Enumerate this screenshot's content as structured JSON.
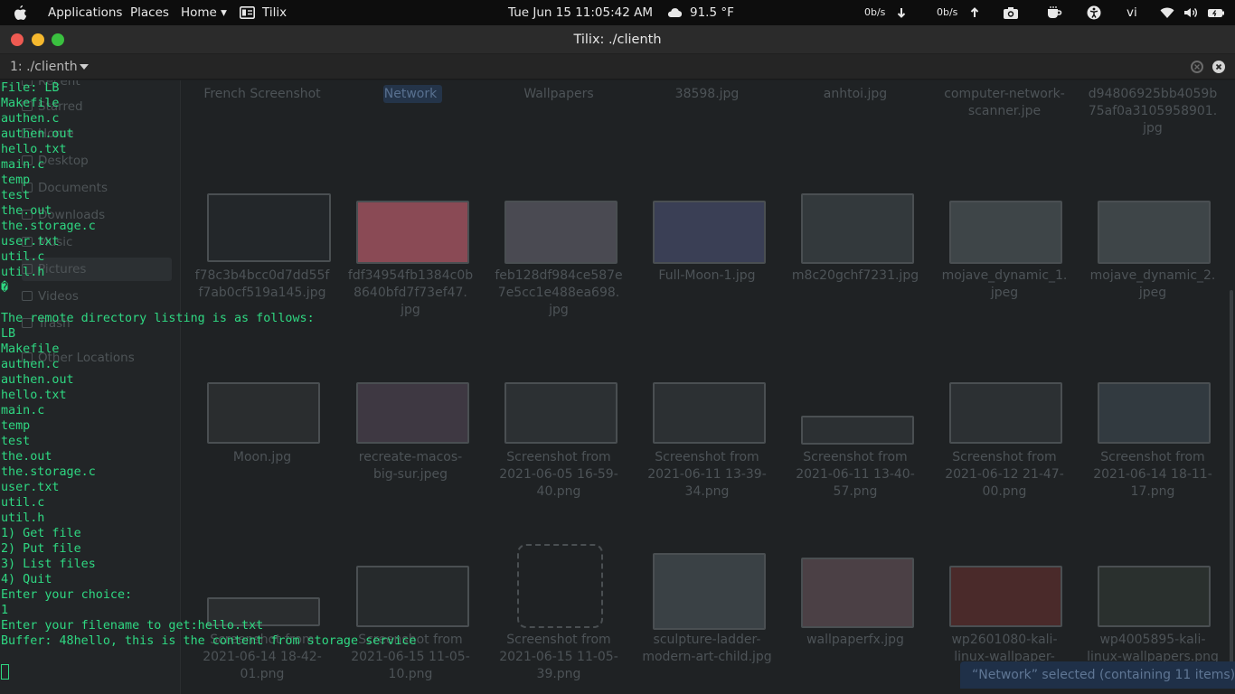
{
  "topbar": {
    "applications": "Applications",
    "places": "Places",
    "home": "Home ▾",
    "app_name": "Tilix",
    "clock": "Tue Jun 15  11:05:42 AM",
    "weather": "91.5 °F",
    "net_down": "0b/s",
    "net_up": "0b/s",
    "keyboard": "vi"
  },
  "window": {
    "title": "Tilix: ./clienth",
    "session_label": "1: ./clienth"
  },
  "terminal": {
    "lines": [
      "File: LB",
      "Makefile",
      "authen.c",
      "authen.out",
      "hello.txt",
      "main.c",
      "temp",
      "test",
      "the.out",
      "the.storage.c",
      "user.txt",
      "util.c",
      "util.h",
      "�",
      "",
      "The remote directory listing is as follows:",
      "LB",
      "Makefile",
      "authen.c",
      "authen.out",
      "hello.txt",
      "main.c",
      "temp",
      "test",
      "the.out",
      "the.storage.c",
      "user.txt",
      "util.c",
      "util.h",
      "1) Get file",
      "2) Put file",
      "3) List files",
      "4) Quit",
      "Enter your choice:",
      "1",
      "Enter your filename to get:hello.txt",
      "Buffer: 48hello, this is the content from storage service"
    ]
  },
  "file_manager": {
    "sidebar": [
      "Recent",
      "Starred",
      "Home",
      "Desktop",
      "Documents",
      "Downloads",
      "Music",
      "Pictures",
      "Videos",
      "Trash",
      "Other Locations"
    ],
    "row0": [
      "French Screenshot",
      "Network",
      "Wallpapers",
      "38598.jpg",
      "anhtoi.jpg",
      "computer-network-\nscanner.jpe",
      "d94806925bb4059b\n75af0a3105958901.\njpg"
    ],
    "row1": [
      "f78c3b4bcc0d7dd55f\nf7ab0cf519a145.jpg",
      "fdf34954fb1384c0b\n8640bfd7f73ef47.\njpg",
      "feb128df984ce587e\n7e5cc1e488ea698.\njpg",
      "Full-Moon-1.jpg",
      "m8c20gchf7231.jpg",
      "mojave_dynamic_1.\njpeg",
      "mojave_dynamic_2.\njpeg"
    ],
    "row2": [
      "Moon.jpg",
      "recreate-macos-\nbig-sur.jpeg",
      "Screenshot from\n2021-06-05 16-59-\n40.png",
      "Screenshot from\n2021-06-11 13-39-\n34.png",
      "Screenshot from\n2021-06-11 13-40-\n57.png",
      "Screenshot from\n2021-06-12 21-47-\n00.png",
      "Screenshot from\n2021-06-14 18-11-\n17.png"
    ],
    "row3": [
      "Screenshot from\n2021-06-14 18-42-\n01.png",
      "Screenshot from\n2021-06-15 11-05-\n10.png",
      "Screenshot from\n2021-06-15 11-05-\n39.png",
      "sculpture-ladder-\nmodern-art-child.jpg",
      "wallpaperfx.jpg",
      "wp2601080-kali-\nlinux-wallpaper-",
      "wp4005895-kali-\nlinux-wallpapers.png"
    ],
    "status": "“Network” selected  (containing 11 items)"
  },
  "colors": {
    "terminal_text": "#2fd882",
    "close": "#ee5a52",
    "minimize": "#f5b82e",
    "maximize": "#3ac03f"
  }
}
